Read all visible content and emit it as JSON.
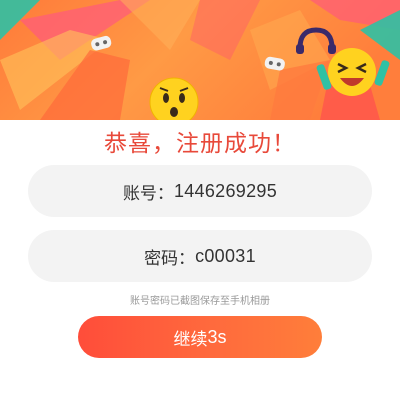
{
  "banner": {
    "icons": [
      "gamepad-icon",
      "gamepad-icon",
      "surprised-emoji-icon",
      "laughing-emoji-icon",
      "headphone-icon"
    ]
  },
  "title": "恭喜，注册成功！",
  "account": {
    "label": "账号：",
    "value": "1446269295"
  },
  "password": {
    "label": "密码：",
    "value": "c00031"
  },
  "hint": "账号密码已截图保存至手机相册",
  "continue_button": {
    "label": "继续",
    "countdown": "3s"
  },
  "colors": {
    "accent": "#e8493a",
    "button_start": "#ff4d3a",
    "button_end": "#ff7e3a",
    "banner_orange": "#ff8a3d",
    "pill_bg": "#f3f3f3"
  }
}
